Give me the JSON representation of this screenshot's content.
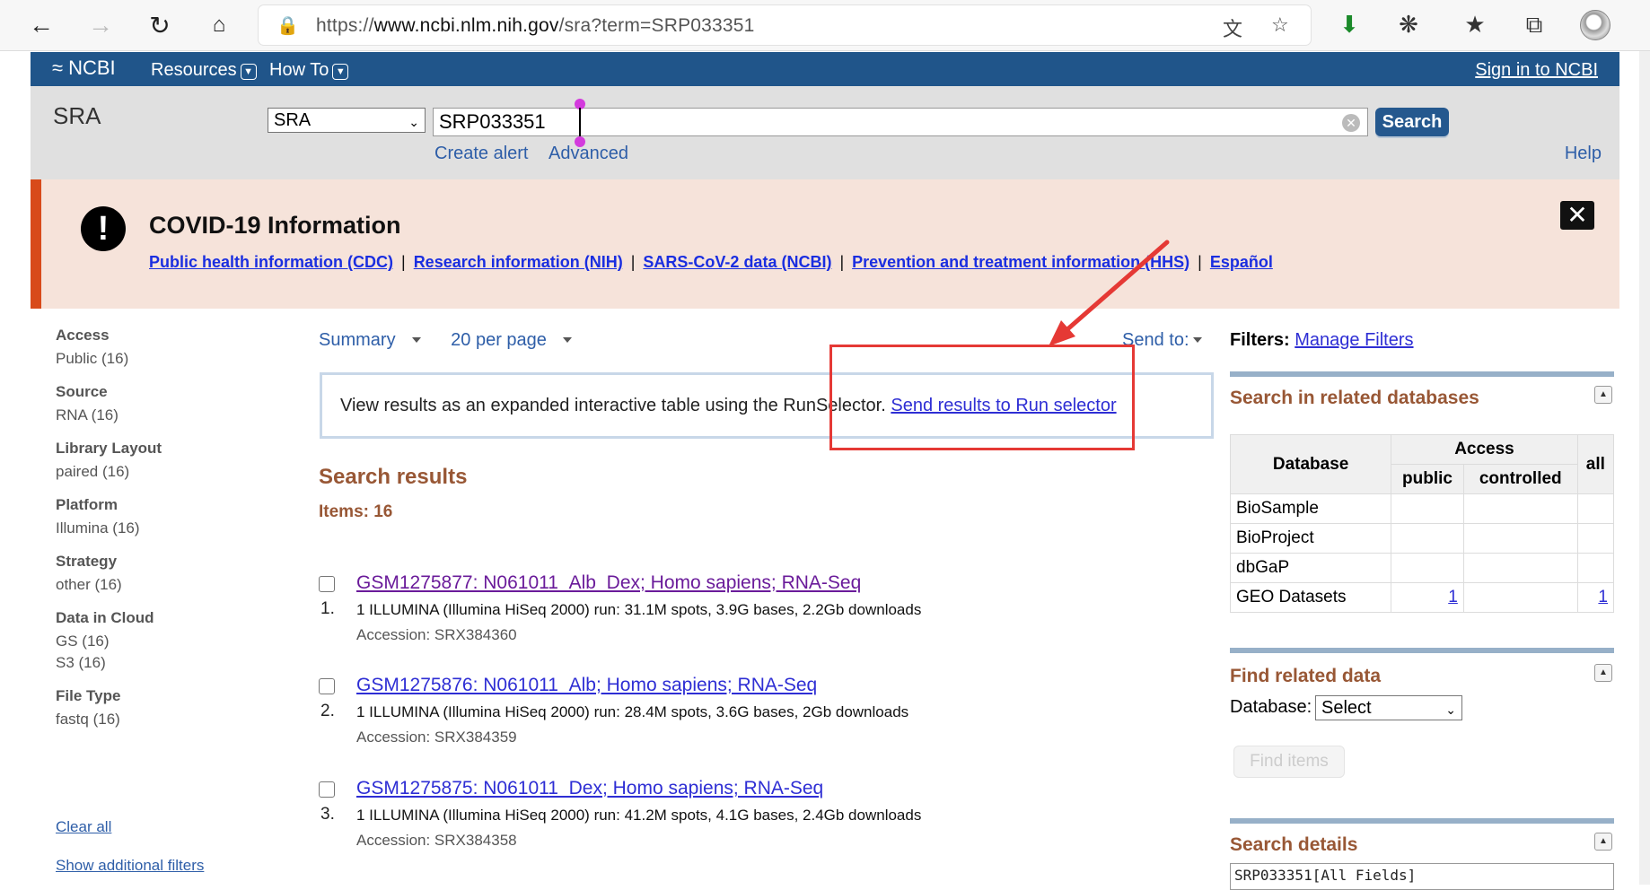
{
  "browser": {
    "url_prefix": "https://",
    "url_host": "www.ncbi.nlm.nih.gov",
    "url_path": "/sra?term=SRP033351",
    "icons": [
      "back-icon",
      "forward-icon",
      "reload-icon",
      "home-icon",
      "lock-icon",
      "translate-icon",
      "favorite-add-icon",
      "download-icon",
      "extensions-icon",
      "favorites-icon",
      "collections-icon",
      "profile-avatar"
    ]
  },
  "ncbi": {
    "logo": "NCBI",
    "menu_resources": "Resources",
    "menu_howto": "How To",
    "signin": "Sign in to NCBI"
  },
  "search": {
    "db_title": "SRA",
    "db_selected": "SRA",
    "term": "SRP033351",
    "button": "Search",
    "create_alert": "Create alert",
    "advanced": "Advanced",
    "help": "Help"
  },
  "covid": {
    "title": "COVID-19 Information",
    "links": [
      "Public health information (CDC)",
      "Research information (NIH)",
      "SARS-CoV-2 data (NCBI)",
      "Prevention and treatment information (HHS)",
      "Español"
    ],
    "separator": "|"
  },
  "filters": [
    {
      "heading": "Access",
      "items": [
        "Public (16)"
      ]
    },
    {
      "heading": "Source",
      "items": [
        "RNA (16)"
      ]
    },
    {
      "heading": "Library Layout",
      "items": [
        "paired (16)"
      ]
    },
    {
      "heading": "Platform",
      "items": [
        "Illumina (16)"
      ]
    },
    {
      "heading": "Strategy",
      "items": [
        "other (16)"
      ]
    },
    {
      "heading": "Data in Cloud",
      "items": [
        "GS (16)",
        "S3 (16)"
      ]
    },
    {
      "heading": "File Type",
      "items": [
        "fastq (16)"
      ]
    }
  ],
  "filter_links": {
    "clear_all": "Clear all",
    "show_additional": "Show additional filters"
  },
  "display": {
    "format": "Summary",
    "per_page": "20 per page",
    "send_to": "Send to:"
  },
  "runselector": {
    "text": "View results as an expanded interactive table using the RunSelector.",
    "link": "Send results to Run selector"
  },
  "results": {
    "title": "Search results",
    "items_label": "Items: 16",
    "list": [
      {
        "num": "1.",
        "title": "GSM1275877: N061011_Alb_Dex; Homo sapiens; RNA-Seq",
        "desc": "1 ILLUMINA (Illumina HiSeq 2000) run: 31.1M spots, 3.9G bases, 2.2Gb downloads",
        "accession": "Accession: SRX384360",
        "visited": true
      },
      {
        "num": "2.",
        "title": "GSM1275876: N061011_Alb; Homo sapiens; RNA-Seq",
        "desc": "1 ILLUMINA (Illumina HiSeq 2000) run: 28.4M spots, 3.6G bases, 2Gb downloads",
        "accession": "Accession: SRX384359",
        "visited": false
      },
      {
        "num": "3.",
        "title": "GSM1275875: N061011_Dex; Homo sapiens; RNA-Seq",
        "desc": "1 ILLUMINA (Illumina HiSeq 2000) run: 41.2M spots, 4.1G bases, 2.4Gb downloads",
        "accession": "Accession: SRX384358",
        "visited": false
      }
    ]
  },
  "right": {
    "filters_label": "Filters:",
    "manage_filters": "Manage Filters",
    "related_title": "Search in related databases",
    "table_headers": {
      "database": "Database",
      "access": "Access",
      "public": "public",
      "controlled": "controlled",
      "all": "all"
    },
    "related_rows": [
      {
        "db": "BioSample",
        "public": "",
        "controlled": "",
        "all": ""
      },
      {
        "db": "BioProject",
        "public": "",
        "controlled": "",
        "all": ""
      },
      {
        "db": "dbGaP",
        "public": "",
        "controlled": "",
        "all": ""
      },
      {
        "db": "GEO Datasets",
        "public": "1",
        "controlled": "",
        "all": "1"
      }
    ],
    "find_title": "Find related data",
    "database_label": "Database:",
    "database_selected": "Select",
    "find_items": "Find items",
    "details_title": "Search details",
    "details_query": "SRP033351[All Fields]"
  },
  "colors": {
    "ncbi_blue": "#20558a",
    "section_brown": "#985735",
    "covid_bg": "#f6e3da",
    "covid_accent": "#d84a1a",
    "annotation_red": "#e53935"
  }
}
